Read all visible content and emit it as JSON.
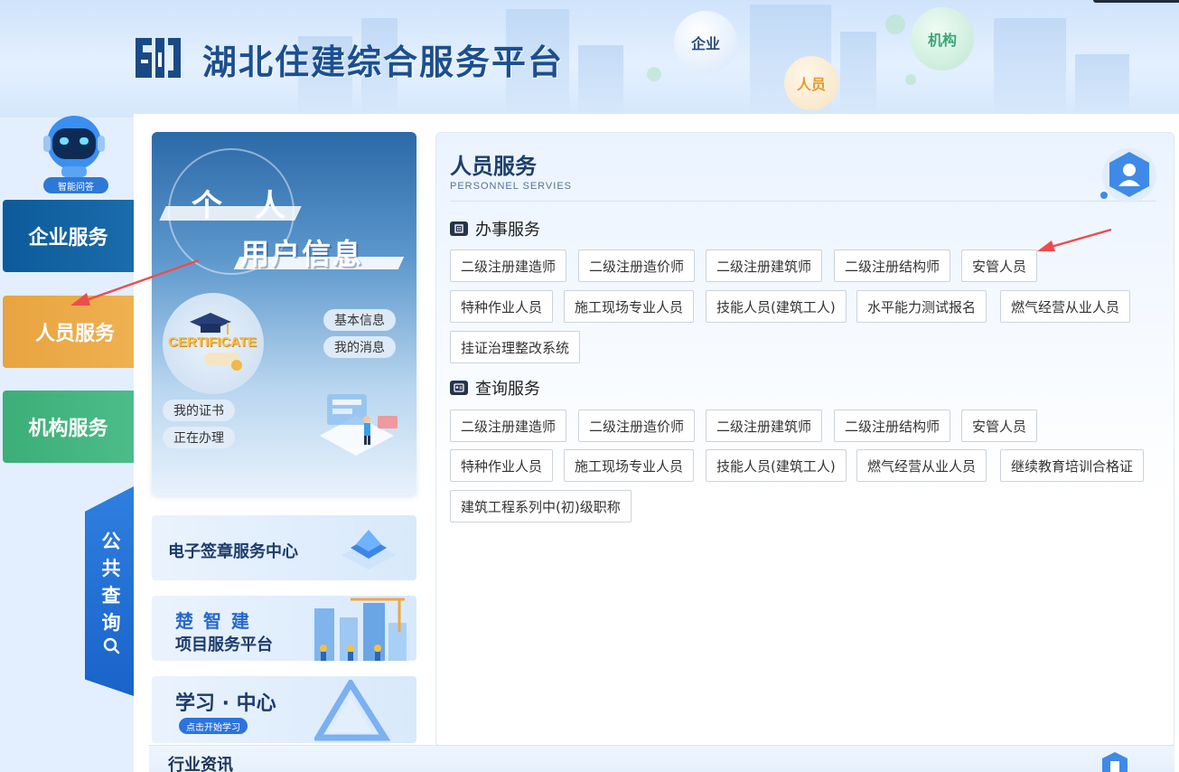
{
  "header": {
    "site_title": "湖北住建综合服务平台",
    "bubbles": {
      "enterprise": "企业",
      "personnel": "人员",
      "institution": "机构"
    }
  },
  "assistant": {
    "label": "智能问答"
  },
  "nav": {
    "enterprise": "企业服务",
    "personnel": "人员服务",
    "institution": "机构服务",
    "public_query": [
      "公",
      "共",
      "查",
      "询"
    ]
  },
  "profile": {
    "title_line1": "个 人",
    "title_line2": "用户信息",
    "certificate_word": "CERTIFICATE",
    "links": {
      "basic_info": "基本信息",
      "my_messages": "我的消息",
      "my_certificates": "我的证书",
      "in_progress": "正在办理"
    }
  },
  "banners": {
    "esign": "电子签章服务中心",
    "czj_line1": "楚 智 建",
    "czj_line2": "项目服务平台",
    "study_title": "学习 · 中心",
    "study_button": "点击开始学习"
  },
  "service_panel": {
    "title": "人员服务",
    "subtitle": "PERSONNEL SERVIES",
    "handling": {
      "heading": "办事服务",
      "items": [
        "二级注册建造师",
        "二级注册造价师",
        "二级注册建筑师",
        "二级注册结构师",
        "安管人员",
        "特种作业人员",
        "施工现场专业人员",
        "技能人员(建筑工人)",
        "水平能力测试报名",
        "燃气经营从业人员",
        "挂证治理整改系统"
      ]
    },
    "query": {
      "heading": "查询服务",
      "items": [
        "二级注册建造师",
        "二级注册造价师",
        "二级注册建筑师",
        "二级注册结构师",
        "安管人员",
        "特种作业人员",
        "施工现场专业人员",
        "技能人员(建筑工人)",
        "燃气经营从业人员",
        "继续教育培训合格证",
        "建筑工程系列中(初)级职称"
      ]
    }
  },
  "news": {
    "title": "行业资讯"
  }
}
